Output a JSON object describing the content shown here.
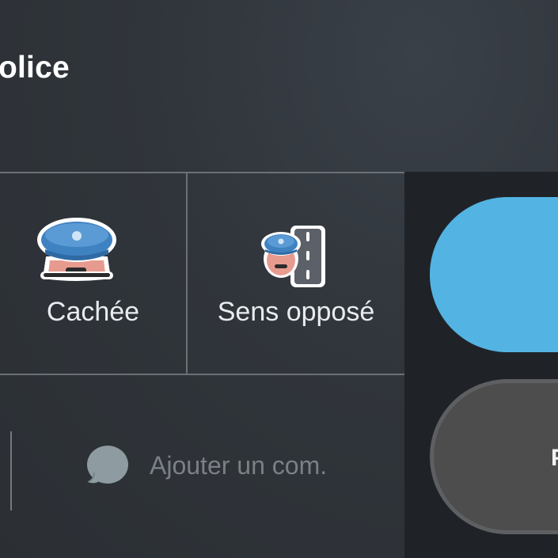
{
  "header": {
    "title": "olice"
  },
  "report_options": [
    {
      "label": "Cachée",
      "icon": "hidden-police-icon"
    },
    {
      "label": "Sens opposé",
      "icon": "opposite-side-police-icon"
    }
  ],
  "comment": {
    "placeholder": "Ajouter un com.",
    "icon": "speech-bubble-icon"
  },
  "actions": {
    "primary_label": "",
    "secondary_label": "P"
  },
  "colors": {
    "background": "#30353b",
    "action_panel": "#1f2328",
    "primary_button": "#53b4e3",
    "secondary_button": "#4d4d4d",
    "divider": "#6b7076"
  }
}
